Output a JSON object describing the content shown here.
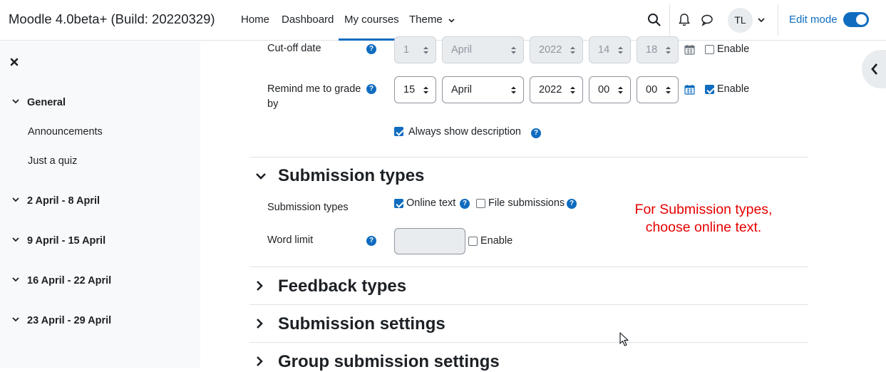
{
  "navbar": {
    "brand": "Moodle 4.0beta+ (Build: 20220329)",
    "links": {
      "home": "Home",
      "dashboard": "Dashboard",
      "my_courses": "My courses",
      "theme": "Theme"
    },
    "avatar_initials": "TL",
    "edit_mode_label": "Edit mode",
    "edit_mode_on": true
  },
  "drawer": {
    "close_icon": "close-icon",
    "sections": [
      {
        "label": "General",
        "activities": [
          "Announcements",
          "Just a quiz"
        ]
      },
      {
        "label": "2 April - 8 April"
      },
      {
        "label": "9 April - 15 April"
      },
      {
        "label": "16 April - 22 April"
      },
      {
        "label": "23 April - 29 April"
      }
    ]
  },
  "form": {
    "cutoff": {
      "label": "Cut-off date",
      "day": "1",
      "month": "April",
      "year": "2022",
      "hour": "14",
      "minute": "18",
      "enable_label": "Enable",
      "enabled": false
    },
    "remind": {
      "label": "Remind me to grade by",
      "day": "15",
      "month": "April",
      "year": "2022",
      "hour": "00",
      "minute": "00",
      "enable_label": "Enable",
      "enabled": true
    },
    "always_show_description": {
      "label": "Always show description",
      "checked": true
    },
    "submission_types_section": {
      "title": "Submission types",
      "field_label": "Submission types",
      "online_text": {
        "label": "Online text",
        "checked": true
      },
      "file_submissions": {
        "label": "File submissions",
        "checked": false
      },
      "word_limit": {
        "label": "Word limit",
        "value": "",
        "enable_label": "Enable",
        "enabled": false
      }
    },
    "collapsed_sections": [
      "Feedback types",
      "Submission settings",
      "Group submission settings"
    ]
  },
  "annotation": {
    "text": "For Submission types, choose online text.",
    "color": "#e60000"
  },
  "colors": {
    "accent": "#0f6cbf",
    "drawer_bg": "#f8f9fa"
  }
}
